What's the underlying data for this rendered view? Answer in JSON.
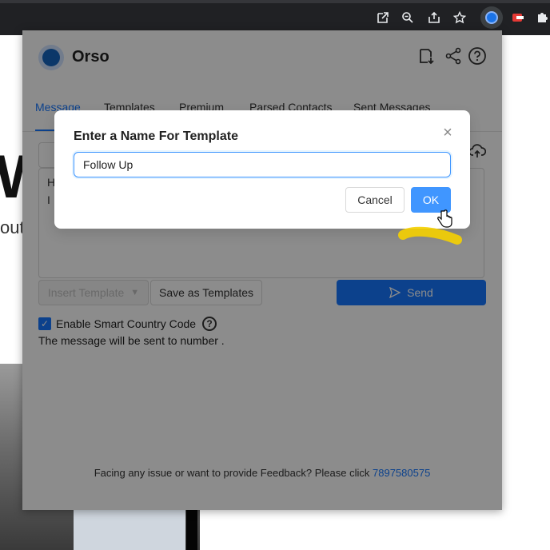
{
  "popup": {
    "app_name": "Orso",
    "tabs": [
      "Message",
      "Templates",
      "Premium",
      "Parsed Contacts",
      "Sent Messages"
    ],
    "message_preview_lines": [
      "H",
      "I"
    ],
    "insert_template_label": "Insert Template",
    "save_templates_label": "Save as Templates",
    "send_label": "Send",
    "smart_country_code_label": "Enable Smart Country Code",
    "note": "The message will be sent to number .",
    "footer_text": "Facing any issue or want to provide Feedback? Please click",
    "footer_link": "7897580575"
  },
  "background": {
    "big_letter": "W",
    "small_text": "out"
  },
  "modal": {
    "title": "Enter a Name For Template",
    "input_value": "Follow Up",
    "cancel_label": "Cancel",
    "ok_label": "OK"
  },
  "colors": {
    "primary": "#1677ff",
    "ok_button": "#4096ff",
    "highlight": "#f5d000"
  }
}
